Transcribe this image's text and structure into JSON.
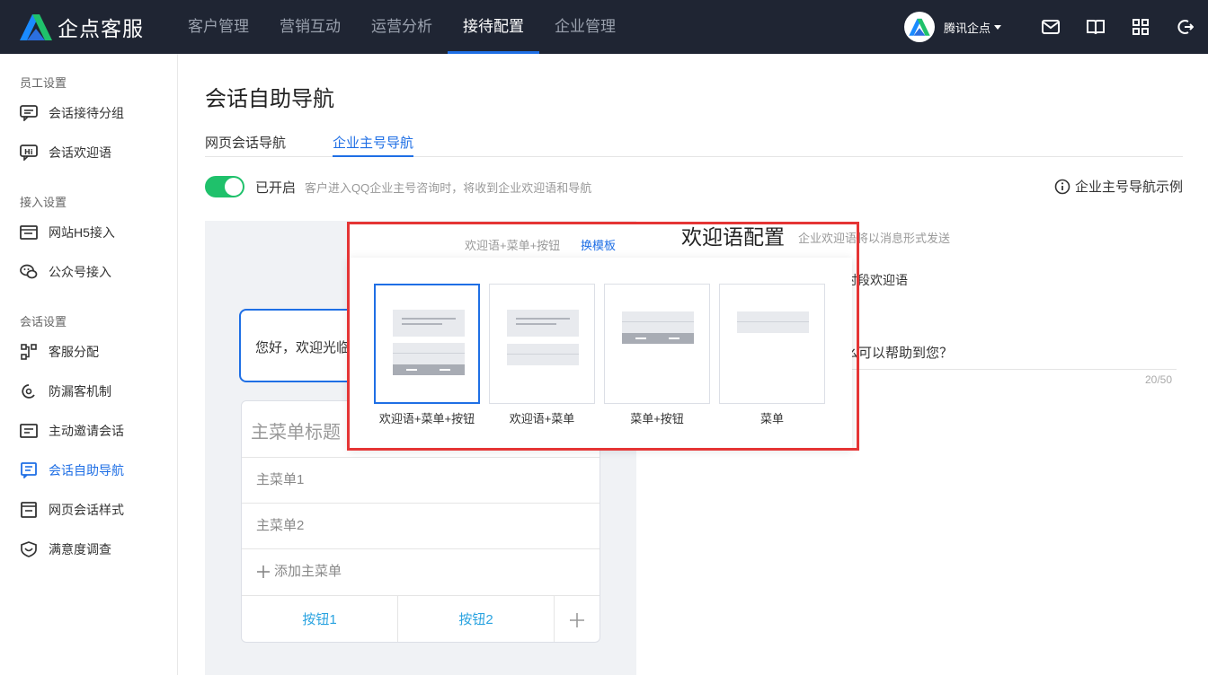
{
  "brand": {
    "name": "企点客服"
  },
  "nav": [
    "客户管理",
    "营销互动",
    "运营分析",
    "接待配置",
    "企业管理"
  ],
  "account": {
    "name": "腾讯企点"
  },
  "sidebar": {
    "sections": [
      "员工设置",
      "接入设置",
      "会话设置"
    ],
    "items": [
      "会话接待分组",
      "会话欢迎语",
      "网站H5接入",
      "公众号接入",
      "客服分配",
      "防漏客机制",
      "主动邀请会话",
      "会话自助导航",
      "网页会话样式",
      "满意度调查"
    ]
  },
  "page": {
    "title": "会话自助导航",
    "tabs": [
      "网页会话导航",
      "企业主号导航"
    ],
    "switch_label": "已开启",
    "switch_desc": "客户进入QQ企业主号咨询时，将收到企业欢迎语和导航",
    "example_link": "企业主号导航示例"
  },
  "preview": {
    "greeting": "您好，欢迎光临",
    "menu_title": "主菜单标题",
    "menu_items": [
      "主菜单1",
      "主菜单2"
    ],
    "add_menu": "添加主菜单",
    "buttons": [
      "按钮1",
      "按钮2"
    ]
  },
  "config": {
    "title": "欢迎语配置",
    "desc": "企业欢迎语将以消息形式发送",
    "frag1": "时段欢迎语",
    "frag2": "么可以帮助到您？",
    "count": "20/50"
  },
  "popover": {
    "current": "欢迎语+菜单+按钮",
    "switch_link": "换模板",
    "templates": [
      "欢迎语+菜单+按钮",
      "欢迎语+菜单",
      "菜单+按钮",
      "菜单"
    ]
  },
  "colors": {
    "accent": "#1f6fe5",
    "topbar": "#1f2533",
    "switch_on": "#1fc16b",
    "highlight": "#e53535"
  }
}
